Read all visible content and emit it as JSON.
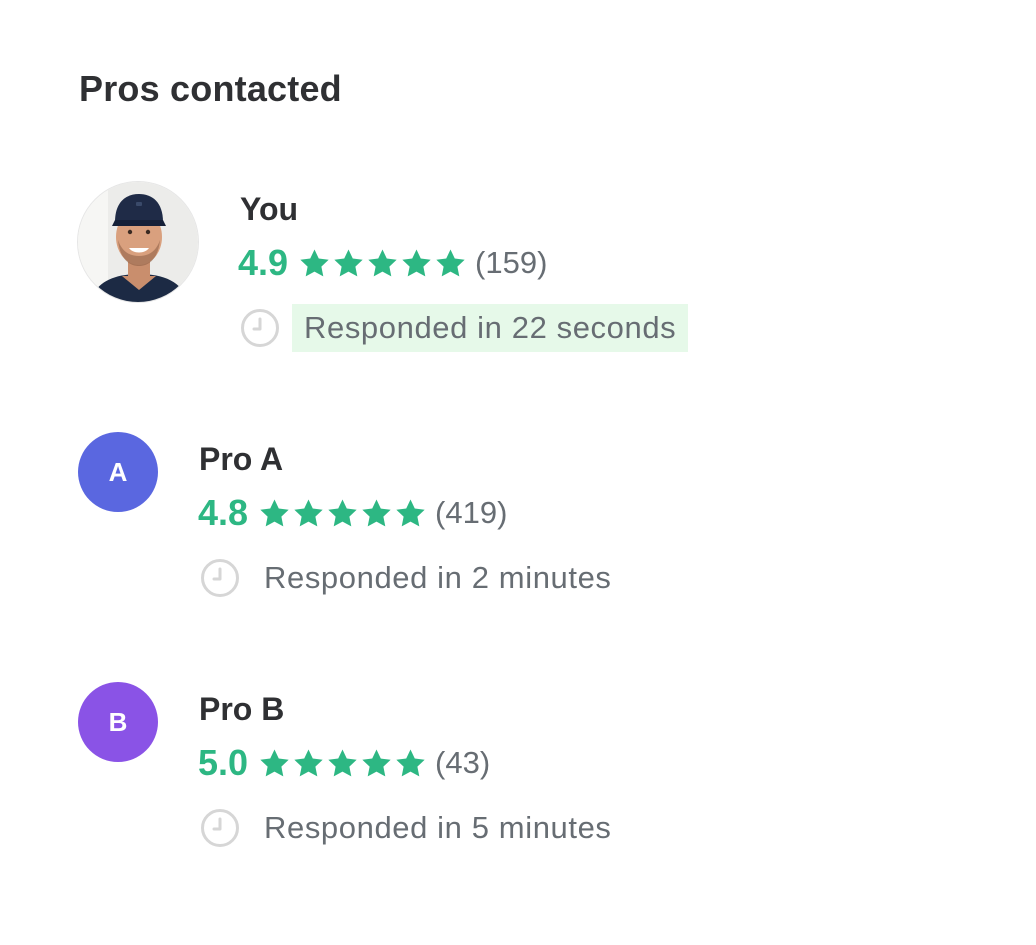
{
  "page": {
    "title": "Pros contacted"
  },
  "pros": [
    {
      "name": "You",
      "avatar": "photo",
      "rating": "4.9",
      "stars": 5,
      "review_count": "(159)",
      "response": "Responded in 22 seconds",
      "response_highlighted": true
    },
    {
      "name": "Pro A",
      "avatar_letter": "A",
      "avatar_color": "#5a67e0",
      "rating": "4.8",
      "stars": 5,
      "review_count": "(419)",
      "response": "Responded in 2 minutes",
      "response_highlighted": false
    },
    {
      "name": "Pro B",
      "avatar_letter": "B",
      "avatar_color": "#8a53e6",
      "rating": "5.0",
      "stars": 5,
      "review_count": "(43)",
      "response": "Responded in 5 minutes",
      "response_highlighted": false
    }
  ],
  "icons": {
    "star": "star-icon",
    "clock": "clock-icon"
  },
  "colors": {
    "rating": "#2db783",
    "highlight": "#e6f9e9",
    "muted_text": "#676d73"
  }
}
